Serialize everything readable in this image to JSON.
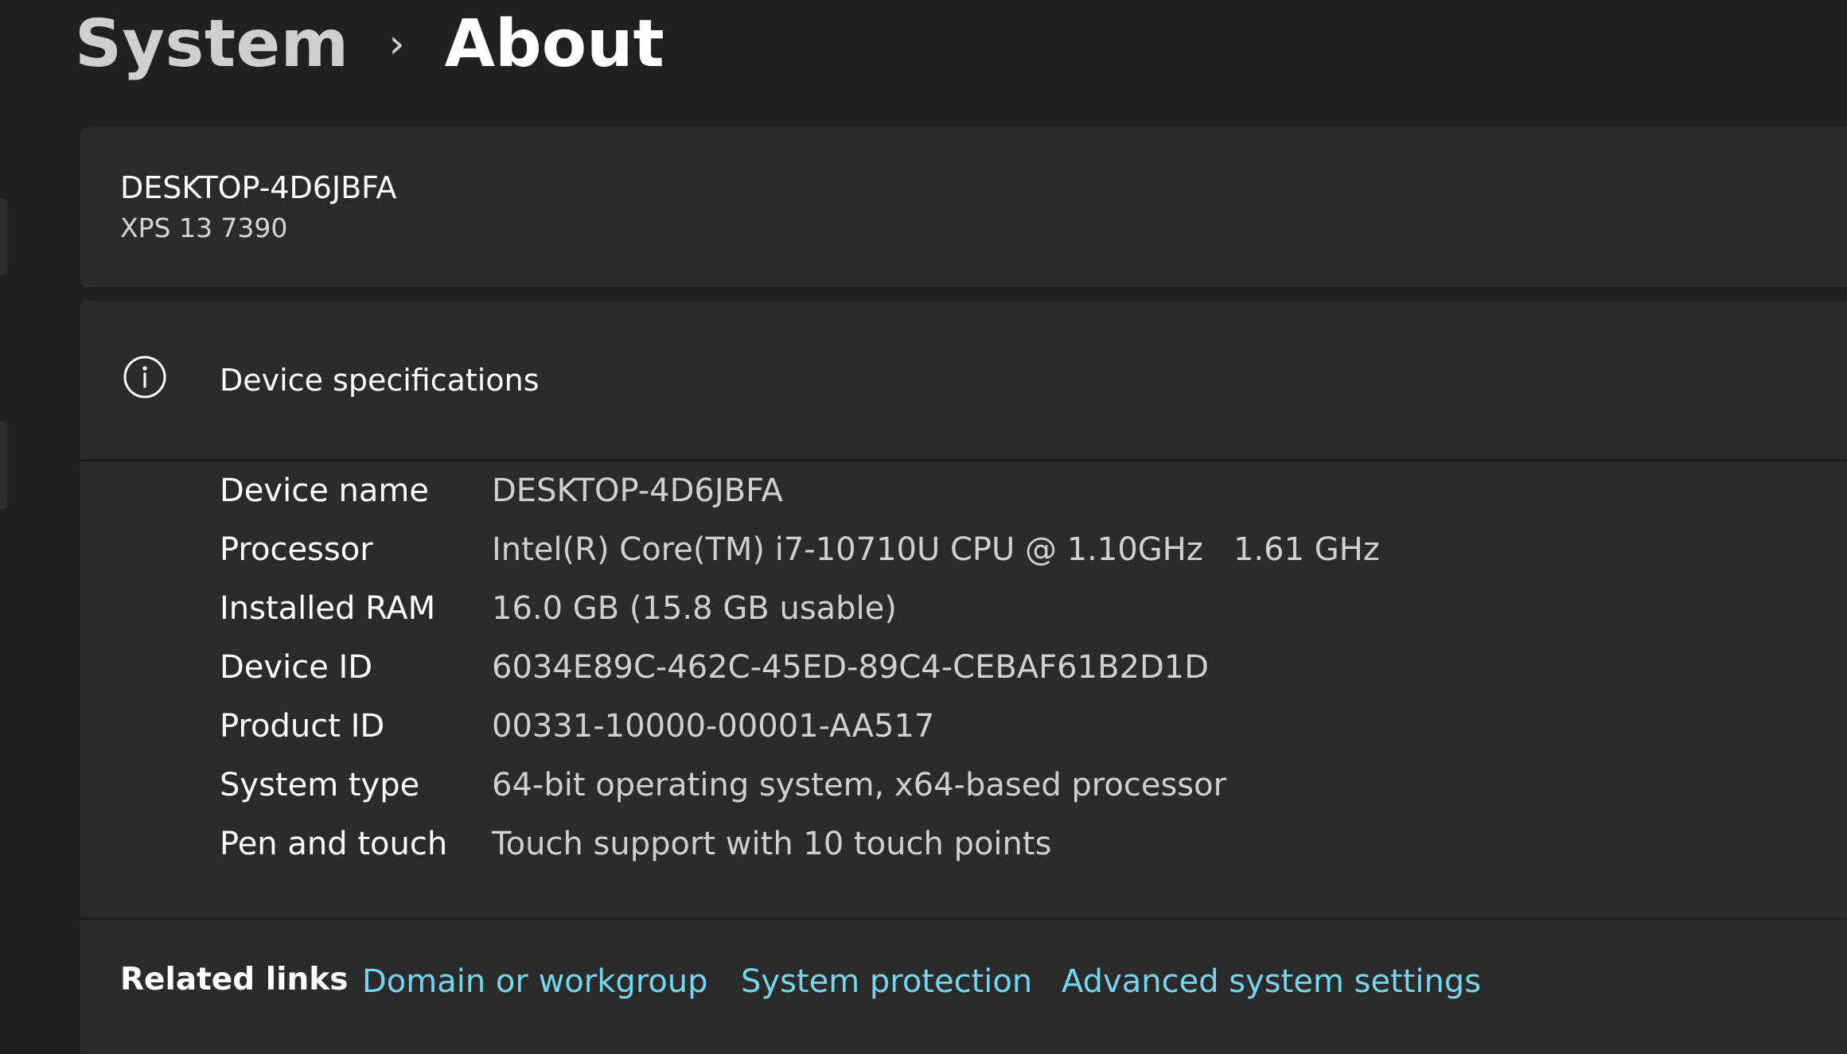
{
  "breadcrumb": {
    "parent": "System",
    "separator": "›",
    "current": "About"
  },
  "device": {
    "name": "DESKTOP-4D6JBFA",
    "model": "XPS 13 7390"
  },
  "specifications": {
    "title": "Device specifications",
    "icon": "info-icon",
    "rows": [
      {
        "label": "Device name",
        "value": "DESKTOP-4D6JBFA"
      },
      {
        "label": "Processor",
        "value": "Intel(R) Core(TM) i7-10710U CPU @ 1.10GHz   1.61 GHz"
      },
      {
        "label": "Installed RAM",
        "value": "16.0 GB (15.8 GB usable)"
      },
      {
        "label": "Device ID",
        "value": "6034E89C-462C-45ED-89C4-CEBAF61B2D1D"
      },
      {
        "label": "Product ID",
        "value": "00331-10000-00001-AA517"
      },
      {
        "label": "System type",
        "value": "64-bit operating system, x64-based processor"
      },
      {
        "label": "Pen and touch",
        "value": "Touch support with 10 touch points"
      }
    ]
  },
  "related_links": {
    "label": "Related links",
    "links": [
      {
        "label": "Domain or workgroup"
      },
      {
        "label": "System protection"
      },
      {
        "label": "Advanced system settings"
      }
    ]
  },
  "colors": {
    "background": "#202020",
    "card": "#2b2b2b",
    "link": "#76d6ee",
    "text_primary": "#ffffff",
    "text_secondary": "#d0d0d0"
  }
}
